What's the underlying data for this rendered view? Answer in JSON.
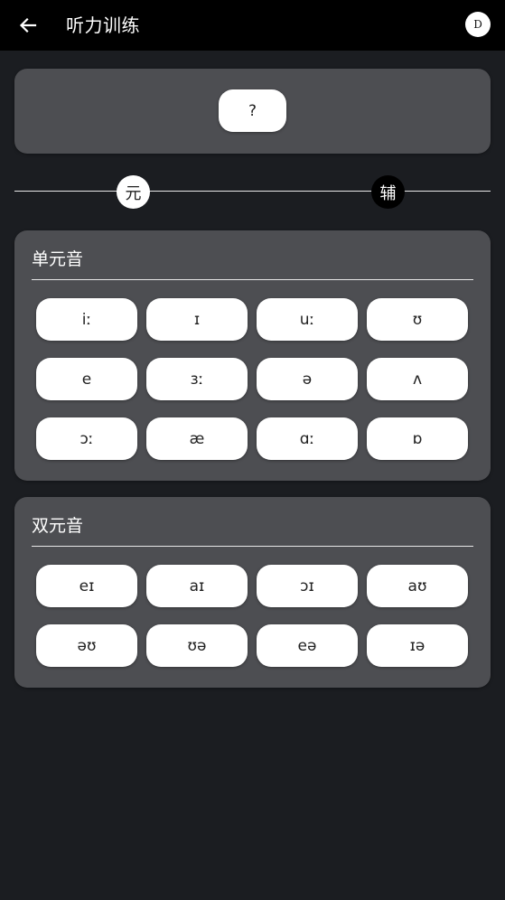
{
  "header": {
    "title": "听力训练",
    "avatar_initial": "D"
  },
  "question": {
    "label": "?"
  },
  "mode_switch": {
    "vowel_label": "元",
    "consonant_label": "辅"
  },
  "monophthongs": {
    "title": "单元音",
    "items": [
      "iː",
      "ɪ",
      "uː",
      "ʊ",
      "e",
      "ɜː",
      "ə",
      "ʌ",
      "ɔː",
      "æ",
      "ɑː",
      "ɒ"
    ]
  },
  "diphthongs": {
    "title": "双元音",
    "items": [
      "eɪ",
      "aɪ",
      "ɔɪ",
      "aʊ",
      "əʊ",
      "ʊə",
      "eə",
      "ɪə"
    ]
  },
  "colors": {
    "background": "#1b1d21",
    "appbar": "#000000",
    "card": "#4d4e52",
    "button": "#ffffff"
  },
  "icons": {
    "back": "arrow-left-icon"
  }
}
